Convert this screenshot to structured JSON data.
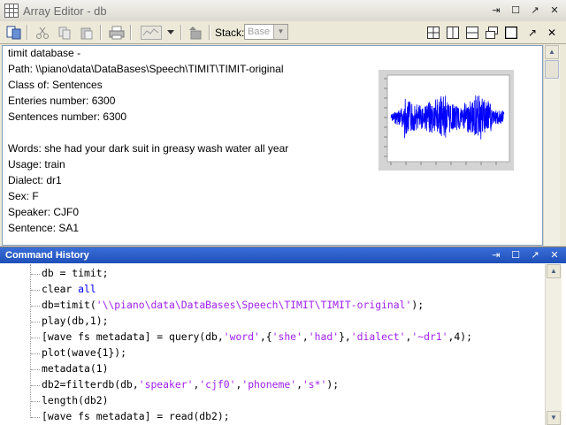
{
  "editor": {
    "title": "Array Editor - db",
    "toolbar": {
      "stack_label": "Stack:",
      "stack_value": "Base"
    },
    "content_lines": [
      "timit database -",
      "Path: \\\\piano\\data\\DataBases\\Speech\\TIMIT\\TIMIT-original",
      "Class of: Sentences",
      "Enteries number: 6300",
      "Sentences number: 6300",
      "",
      "Words: she had your dark suit in greasy wash water all year",
      "Usage: train",
      "Dialect: dr1",
      "Sex: F",
      "Speaker: CJF0",
      "Sentence: SA1"
    ]
  },
  "history": {
    "title": "Command History",
    "lines": [
      [
        {
          "t": "db = timit;",
          "c": "n"
        }
      ],
      [
        {
          "t": "clear ",
          "c": "n"
        },
        {
          "t": "all",
          "c": "k"
        }
      ],
      [
        {
          "t": "db=timit(",
          "c": "n"
        },
        {
          "t": "'\\\\piano\\data\\DataBases\\Speech\\TIMIT\\TIMIT-original'",
          "c": "s"
        },
        {
          "t": ");",
          "c": "n"
        }
      ],
      [
        {
          "t": "play(db,1);",
          "c": "n"
        }
      ],
      [
        {
          "t": "[wave fs metadata] = query(db,",
          "c": "n"
        },
        {
          "t": "'word'",
          "c": "s"
        },
        {
          "t": ",{",
          "c": "n"
        },
        {
          "t": "'she'",
          "c": "s"
        },
        {
          "t": ",",
          "c": "n"
        },
        {
          "t": "'had'",
          "c": "s"
        },
        {
          "t": "},",
          "c": "n"
        },
        {
          "t": "'dialect'",
          "c": "s"
        },
        {
          "t": ",",
          "c": "n"
        },
        {
          "t": "'~dr1'",
          "c": "s"
        },
        {
          "t": ",4);",
          "c": "n"
        }
      ],
      [
        {
          "t": "plot(wave{1});",
          "c": "n"
        }
      ],
      [
        {
          "t": "metadata(1)",
          "c": "n"
        }
      ],
      [
        {
          "t": "db2=filterdb(db,",
          "c": "n"
        },
        {
          "t": "'speaker'",
          "c": "s"
        },
        {
          "t": ",",
          "c": "n"
        },
        {
          "t": "'cjf0'",
          "c": "s"
        },
        {
          "t": ",",
          "c": "n"
        },
        {
          "t": "'phoneme'",
          "c": "s"
        },
        {
          "t": ",",
          "c": "n"
        },
        {
          "t": "'s*'",
          "c": "s"
        },
        {
          "t": ");",
          "c": "n"
        }
      ],
      [
        {
          "t": "length(db2)",
          "c": "n"
        }
      ],
      [
        {
          "t": "[wave fs metadata] = read(db2);",
          "c": "n"
        }
      ]
    ]
  },
  "colors": {
    "keyword": "#0000ff",
    "string": "#a020f0",
    "history_title_bg": "#2a5fcc",
    "waveform": "#0000ff"
  }
}
